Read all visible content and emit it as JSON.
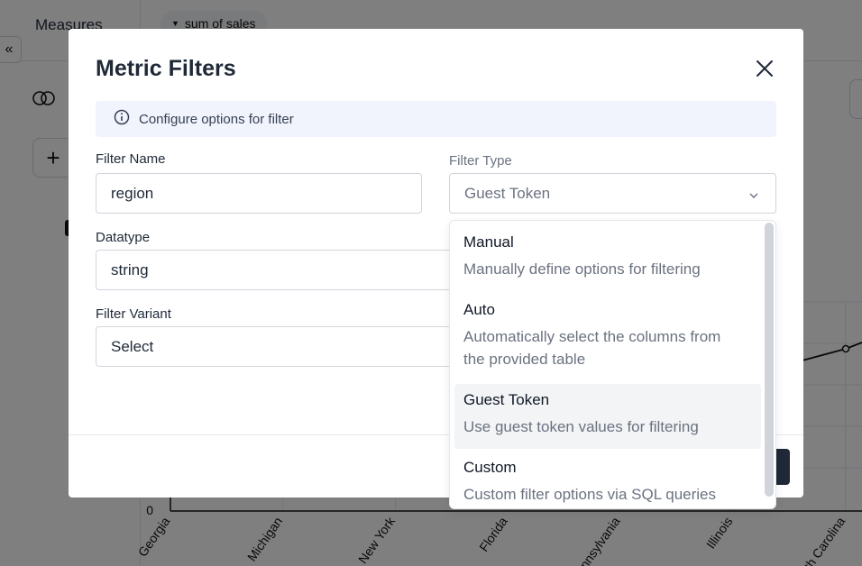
{
  "background": {
    "measures_label": "Measures",
    "pill_label": "sum of sales",
    "collapse_glyph": "«",
    "chart_data": {
      "type": "line",
      "categories": [
        "Georgia",
        "Michigan",
        "New York",
        "Florida",
        "Pennsylvania",
        "Illinois",
        "North Carolina"
      ],
      "y_tick_zero": "0"
    }
  },
  "modal": {
    "title": "Metric Filters",
    "info_text": "Configure options for filter",
    "filter_name": {
      "label": "Filter Name",
      "value": "region"
    },
    "filter_type": {
      "label": "Filter Type",
      "value": "Guest Token"
    },
    "datatype": {
      "label": "Datatype",
      "value": "string"
    },
    "filter_variant": {
      "label": "Filter Variant",
      "value": "Select"
    }
  },
  "dropdown": {
    "options": [
      {
        "title": "Manual",
        "desc1": "Manually define options for filtering",
        "desc2": ""
      },
      {
        "title": "Auto",
        "desc1": "Automatically select the columns from",
        "desc2": "the provided table"
      },
      {
        "title": "Guest Token",
        "desc1": "Use guest token values for filtering",
        "desc2": ""
      },
      {
        "title": "Custom",
        "desc1": "Custom filter options via SQL queries",
        "desc2": ""
      }
    ]
  }
}
